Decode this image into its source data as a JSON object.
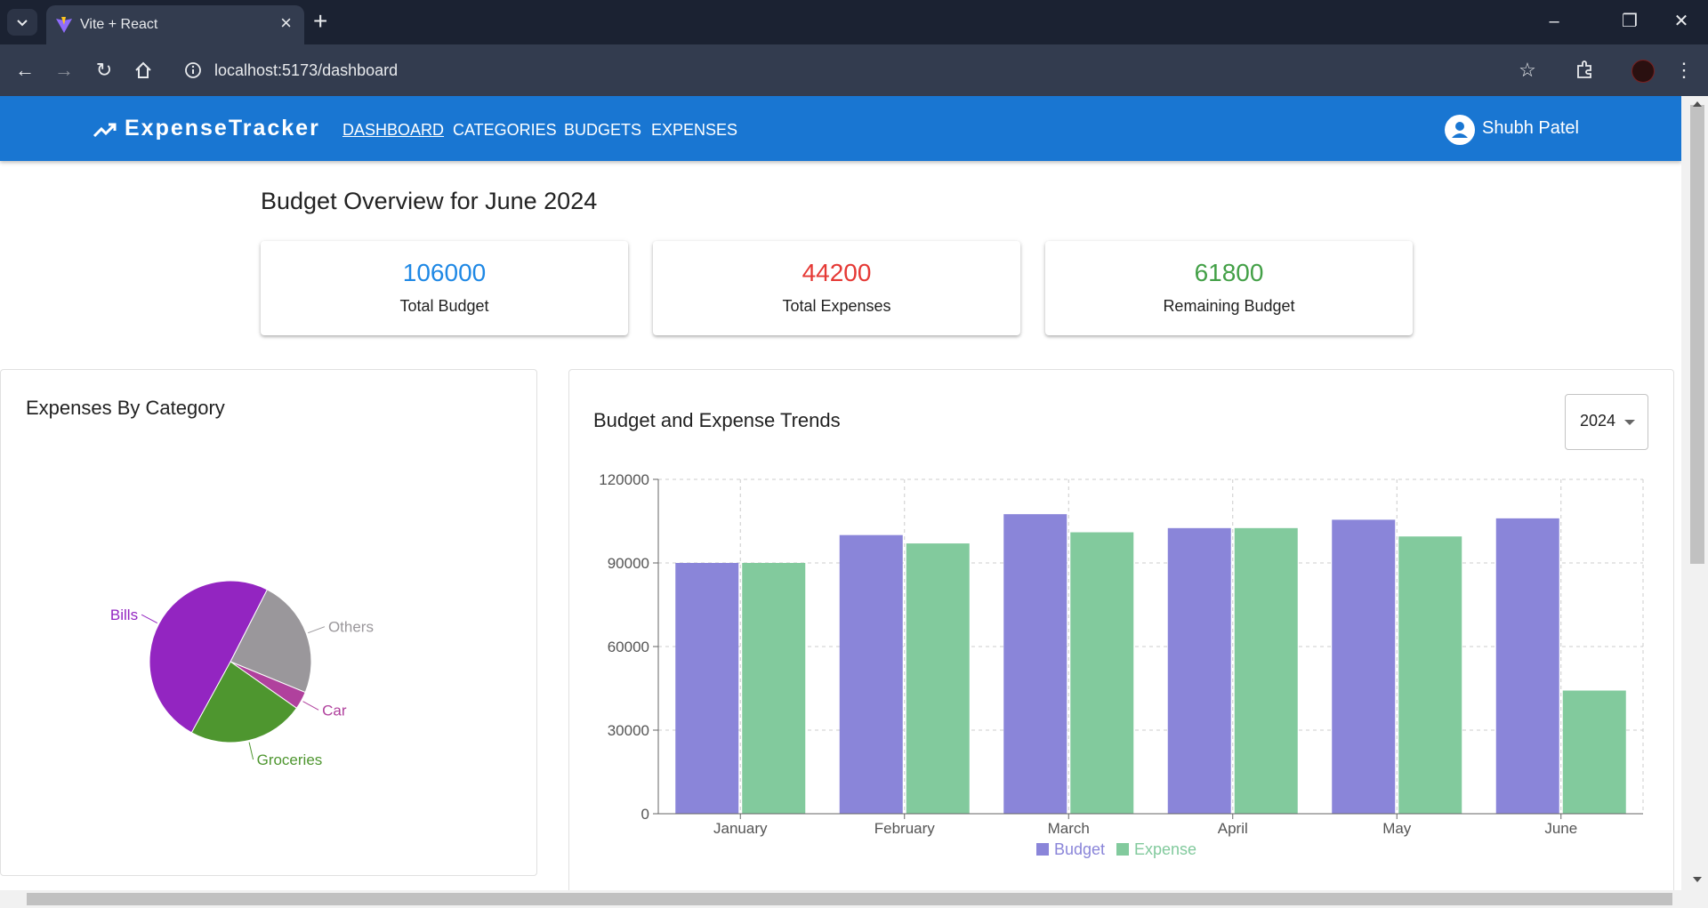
{
  "browser": {
    "tab_title": "Vite + React",
    "url": "localhost:5173/dashboard"
  },
  "app": {
    "brand": "ExpenseTracker",
    "nav": [
      {
        "label": "DASHBOARD",
        "active": true
      },
      {
        "label": "CATEGORIES",
        "active": false
      },
      {
        "label": "BUDGETS",
        "active": false
      },
      {
        "label": "EXPENSES",
        "active": false
      }
    ],
    "user_name": "Shubh Patel",
    "colors": {
      "appbar": "#1976d2",
      "budget": "#1e88e5",
      "expenses": "#e53935",
      "remaining": "#43a047"
    }
  },
  "overview": {
    "title": "Budget Overview for June 2024",
    "cards": [
      {
        "value": "106000",
        "label": "Total Budget",
        "color": "#1e88e5"
      },
      {
        "value": "44200",
        "label": "Total Expenses",
        "color": "#e53935"
      },
      {
        "value": "61800",
        "label": "Remaining Budget",
        "color": "#43a047"
      }
    ]
  },
  "pie_panel": {
    "title": "Expenses By Category"
  },
  "trend_panel": {
    "title": "Budget and Expense Trends",
    "year_select": "2024"
  },
  "chart_data": [
    {
      "type": "pie",
      "title": "Expenses By Category",
      "labels": [
        "Others",
        "Car",
        "Groceries",
        "Bills"
      ],
      "values": [
        10000,
        1500,
        9800,
        20900
      ],
      "colors": [
        "#9a979b",
        "#b0419d",
        "#4e962f",
        "#9325c1"
      ]
    },
    {
      "type": "bar",
      "title": "Budget and Expense Trends",
      "categories": [
        "January",
        "February",
        "March",
        "April",
        "May",
        "June"
      ],
      "series": [
        {
          "name": "Budget",
          "color": "#8a85d9",
          "values": [
            90000,
            100000,
            107500,
            102500,
            105500,
            106000
          ]
        },
        {
          "name": "Expense",
          "color": "#82ca9d",
          "values": [
            90000,
            97000,
            101000,
            102500,
            99500,
            44200
          ]
        }
      ],
      "y_ticks": [
        "0",
        "30000",
        "60000",
        "90000",
        "120000"
      ],
      "ylim": [
        0,
        120000
      ],
      "grid": true,
      "legend": "bottom"
    }
  ]
}
